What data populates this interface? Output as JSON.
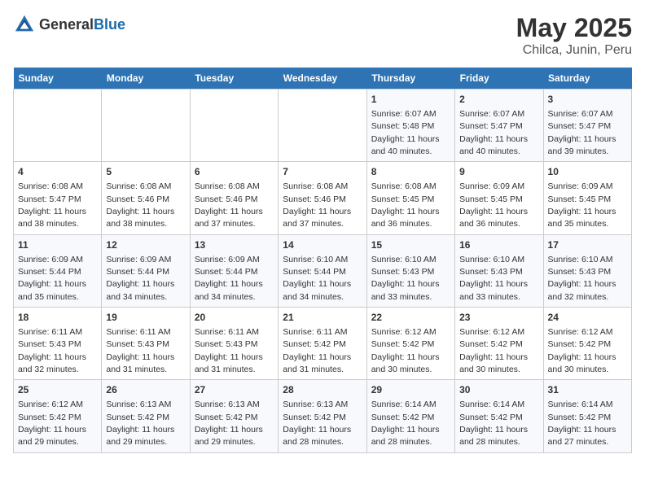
{
  "header": {
    "logo_general": "General",
    "logo_blue": "Blue",
    "title": "May 2025",
    "subtitle": "Chilca, Junin, Peru"
  },
  "weekdays": [
    "Sunday",
    "Monday",
    "Tuesday",
    "Wednesday",
    "Thursday",
    "Friday",
    "Saturday"
  ],
  "weeks": [
    [
      {
        "day": "",
        "info": ""
      },
      {
        "day": "",
        "info": ""
      },
      {
        "day": "",
        "info": ""
      },
      {
        "day": "",
        "info": ""
      },
      {
        "day": "1",
        "info": "Sunrise: 6:07 AM\nSunset: 5:48 PM\nDaylight: 11 hours and 40 minutes."
      },
      {
        "day": "2",
        "info": "Sunrise: 6:07 AM\nSunset: 5:47 PM\nDaylight: 11 hours and 40 minutes."
      },
      {
        "day": "3",
        "info": "Sunrise: 6:07 AM\nSunset: 5:47 PM\nDaylight: 11 hours and 39 minutes."
      }
    ],
    [
      {
        "day": "4",
        "info": "Sunrise: 6:08 AM\nSunset: 5:47 PM\nDaylight: 11 hours and 38 minutes."
      },
      {
        "day": "5",
        "info": "Sunrise: 6:08 AM\nSunset: 5:46 PM\nDaylight: 11 hours and 38 minutes."
      },
      {
        "day": "6",
        "info": "Sunrise: 6:08 AM\nSunset: 5:46 PM\nDaylight: 11 hours and 37 minutes."
      },
      {
        "day": "7",
        "info": "Sunrise: 6:08 AM\nSunset: 5:46 PM\nDaylight: 11 hours and 37 minutes."
      },
      {
        "day": "8",
        "info": "Sunrise: 6:08 AM\nSunset: 5:45 PM\nDaylight: 11 hours and 36 minutes."
      },
      {
        "day": "9",
        "info": "Sunrise: 6:09 AM\nSunset: 5:45 PM\nDaylight: 11 hours and 36 minutes."
      },
      {
        "day": "10",
        "info": "Sunrise: 6:09 AM\nSunset: 5:45 PM\nDaylight: 11 hours and 35 minutes."
      }
    ],
    [
      {
        "day": "11",
        "info": "Sunrise: 6:09 AM\nSunset: 5:44 PM\nDaylight: 11 hours and 35 minutes."
      },
      {
        "day": "12",
        "info": "Sunrise: 6:09 AM\nSunset: 5:44 PM\nDaylight: 11 hours and 34 minutes."
      },
      {
        "day": "13",
        "info": "Sunrise: 6:09 AM\nSunset: 5:44 PM\nDaylight: 11 hours and 34 minutes."
      },
      {
        "day": "14",
        "info": "Sunrise: 6:10 AM\nSunset: 5:44 PM\nDaylight: 11 hours and 34 minutes."
      },
      {
        "day": "15",
        "info": "Sunrise: 6:10 AM\nSunset: 5:43 PM\nDaylight: 11 hours and 33 minutes."
      },
      {
        "day": "16",
        "info": "Sunrise: 6:10 AM\nSunset: 5:43 PM\nDaylight: 11 hours and 33 minutes."
      },
      {
        "day": "17",
        "info": "Sunrise: 6:10 AM\nSunset: 5:43 PM\nDaylight: 11 hours and 32 minutes."
      }
    ],
    [
      {
        "day": "18",
        "info": "Sunrise: 6:11 AM\nSunset: 5:43 PM\nDaylight: 11 hours and 32 minutes."
      },
      {
        "day": "19",
        "info": "Sunrise: 6:11 AM\nSunset: 5:43 PM\nDaylight: 11 hours and 31 minutes."
      },
      {
        "day": "20",
        "info": "Sunrise: 6:11 AM\nSunset: 5:43 PM\nDaylight: 11 hours and 31 minutes."
      },
      {
        "day": "21",
        "info": "Sunrise: 6:11 AM\nSunset: 5:42 PM\nDaylight: 11 hours and 31 minutes."
      },
      {
        "day": "22",
        "info": "Sunrise: 6:12 AM\nSunset: 5:42 PM\nDaylight: 11 hours and 30 minutes."
      },
      {
        "day": "23",
        "info": "Sunrise: 6:12 AM\nSunset: 5:42 PM\nDaylight: 11 hours and 30 minutes."
      },
      {
        "day": "24",
        "info": "Sunrise: 6:12 AM\nSunset: 5:42 PM\nDaylight: 11 hours and 30 minutes."
      }
    ],
    [
      {
        "day": "25",
        "info": "Sunrise: 6:12 AM\nSunset: 5:42 PM\nDaylight: 11 hours and 29 minutes."
      },
      {
        "day": "26",
        "info": "Sunrise: 6:13 AM\nSunset: 5:42 PM\nDaylight: 11 hours and 29 minutes."
      },
      {
        "day": "27",
        "info": "Sunrise: 6:13 AM\nSunset: 5:42 PM\nDaylight: 11 hours and 29 minutes."
      },
      {
        "day": "28",
        "info": "Sunrise: 6:13 AM\nSunset: 5:42 PM\nDaylight: 11 hours and 28 minutes."
      },
      {
        "day": "29",
        "info": "Sunrise: 6:14 AM\nSunset: 5:42 PM\nDaylight: 11 hours and 28 minutes."
      },
      {
        "day": "30",
        "info": "Sunrise: 6:14 AM\nSunset: 5:42 PM\nDaylight: 11 hours and 28 minutes."
      },
      {
        "day": "31",
        "info": "Sunrise: 6:14 AM\nSunset: 5:42 PM\nDaylight: 11 hours and 27 minutes."
      }
    ]
  ]
}
